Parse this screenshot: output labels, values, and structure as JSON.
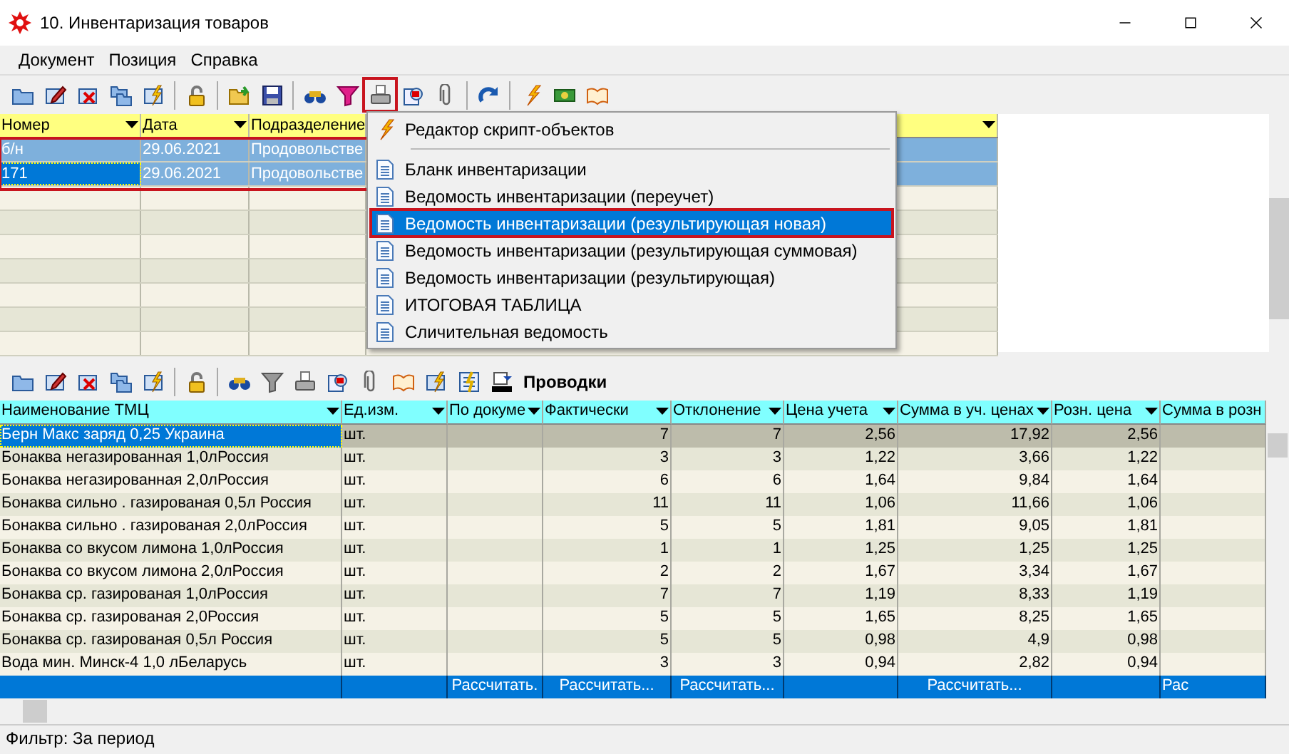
{
  "window": {
    "title": "10. Инвентаризация товаров"
  },
  "menu": [
    "Документ",
    "Позиция",
    "Справка"
  ],
  "toolbar": {
    "print_button_highlighted": true
  },
  "upper_grid": {
    "columns": [
      "Номер",
      "Дата",
      "Подразделение"
    ],
    "rows": [
      {
        "number": "б/н",
        "date": "29.06.2021",
        "department": "Продовольстве",
        "selected": true,
        "current": false
      },
      {
        "number": "171",
        "date": "29.06.2021",
        "department": "Продовольстве",
        "selected": true,
        "current": true
      }
    ],
    "selection_highlighted": true
  },
  "popup_menu": [
    {
      "kind": "script",
      "label": "Редактор скрипт-объектов",
      "selected": false,
      "highlighted": false
    },
    {
      "kind": "separator"
    },
    {
      "kind": "report",
      "label": "Бланк инвентаризации",
      "selected": false,
      "highlighted": false
    },
    {
      "kind": "report",
      "label": "Ведомость инвентаризации (переучет)",
      "selected": false,
      "highlighted": false
    },
    {
      "kind": "report",
      "label": "Ведомость инвентаризации (результирующая новая)",
      "selected": true,
      "highlighted": true
    },
    {
      "kind": "report",
      "label": "Ведомость инвентаризации (результирующая суммовая)",
      "selected": false,
      "highlighted": false
    },
    {
      "kind": "report",
      "label": "Ведомость инвентаризации (результирующая)",
      "selected": false,
      "highlighted": false
    },
    {
      "kind": "report",
      "label": "ИТОГОВАЯ ТАБЛИЦА",
      "selected": false,
      "highlighted": false
    },
    {
      "kind": "report",
      "label": "Сличительная ведомость",
      "selected": false,
      "highlighted": false
    }
  ],
  "lower_toolbar": {
    "postings_button": "Проводки"
  },
  "lower_grid": {
    "columns": [
      "Наименование ТМЦ",
      "Ед.изм.",
      "По докуме",
      "Фактически",
      "Отклонение",
      "Цена учета",
      "Сумма в уч. ценах",
      "Розн. цена",
      "Сумма в розн"
    ],
    "rows": [
      {
        "selected": true,
        "name": "Берн Макс заряд 0,25 Украина",
        "unit": "шт.",
        "actual": "7",
        "deviation": "7",
        "price": "2,56",
        "sum": "17,92",
        "retail_price": "2,56"
      },
      {
        "selected": false,
        "name": "Бонаква  негазированная 1,0лРоссия",
        "unit": "шт.",
        "actual": "3",
        "deviation": "3",
        "price": "1,22",
        "sum": "3,66",
        "retail_price": "1,22"
      },
      {
        "selected": false,
        "name": "Бонаква  негазированная 2,0лРоссия",
        "unit": "шт.",
        "actual": "6",
        "deviation": "6",
        "price": "1,64",
        "sum": "9,84",
        "retail_price": "1,64"
      },
      {
        "selected": false,
        "name": "Бонаква  сильно . газированая 0,5л Россия",
        "unit": "шт.",
        "actual": "11",
        "deviation": "11",
        "price": "1,06",
        "sum": "11,66",
        "retail_price": "1,06"
      },
      {
        "selected": false,
        "name": "Бонаква  сильно . газированая 2,0лРоссия",
        "unit": "шт.",
        "actual": "5",
        "deviation": "5",
        "price": "1,81",
        "sum": "9,05",
        "retail_price": "1,81"
      },
      {
        "selected": false,
        "name": "Бонаква  со вкусом лимона  1,0лРоссия",
        "unit": "шт.",
        "actual": "1",
        "deviation": "1",
        "price": "1,25",
        "sum": "1,25",
        "retail_price": "1,25"
      },
      {
        "selected": false,
        "name": "Бонаква  со вкусом лимона  2,0лРоссия",
        "unit": "шт.",
        "actual": "2",
        "deviation": "2",
        "price": "1,67",
        "sum": "3,34",
        "retail_price": "1,67"
      },
      {
        "selected": false,
        "name": "Бонаква  ср. газированая  1,0лРоссия",
        "unit": "шт.",
        "actual": "7",
        "deviation": "7",
        "price": "1,19",
        "sum": "8,33",
        "retail_price": "1,19"
      },
      {
        "selected": false,
        "name": "Бонаква  ср. газированая  2,0Россия",
        "unit": "шт.",
        "actual": "5",
        "deviation": "5",
        "price": "1,65",
        "sum": "8,25",
        "retail_price": "1,65"
      },
      {
        "selected": false,
        "name": "Бонаква  ср. газированая 0,5л Россия",
        "unit": "шт.",
        "actual": "5",
        "deviation": "5",
        "price": "0,98",
        "sum": "4,9",
        "retail_price": "0,98"
      },
      {
        "selected": false,
        "name": "Вода мин. Минск-4   1,0 лБеларусь",
        "unit": "шт.",
        "actual": "3",
        "deviation": "3",
        "price": "0,94",
        "sum": "2,82",
        "retail_price": "0,94"
      }
    ],
    "totals_row": {
      "by_document": "Рассчитать.",
      "actual": "Рассчитать...",
      "deviation": "Рассчитать...",
      "sum": "Рассчитать...",
      "retail_sum": "Рас"
    }
  },
  "status_bar": {
    "filter": "Фильтр: За период"
  }
}
